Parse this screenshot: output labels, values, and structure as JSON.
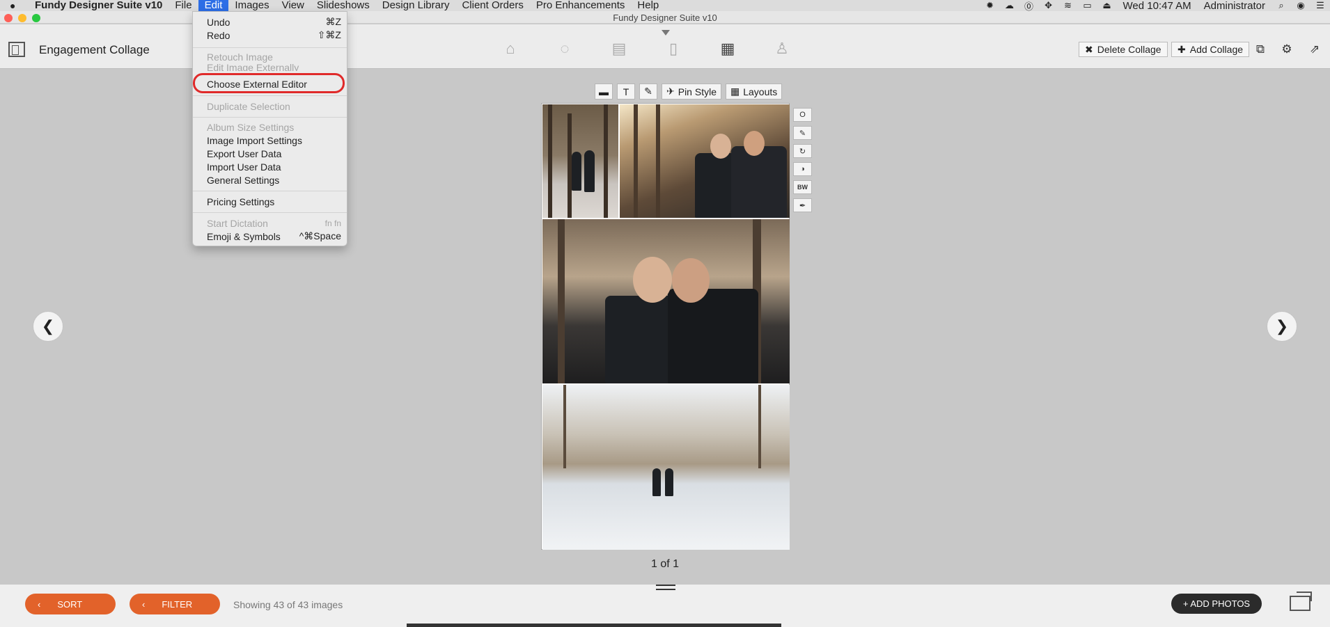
{
  "menubar": {
    "apple": "",
    "app_name": "Fundy Designer Suite v10",
    "items": [
      "File",
      "Edit",
      "Images",
      "View",
      "Slideshows",
      "Design Library",
      "Client Orders",
      "Pro Enhancements",
      "Help"
    ],
    "clock": "Wed 10:47 AM",
    "user": "Administrator",
    "status_icons": [
      "gear-burst-icon",
      "cloud-icon",
      "onepassword-icon",
      "move-icon",
      "wifi-icon",
      "airplay-icon",
      "eject-icon",
      "search-icon",
      "siri-icon",
      "list-icon"
    ]
  },
  "window": {
    "title": "Fundy Designer Suite v10"
  },
  "toolbar": {
    "collage_title": "Engagement Collage",
    "modules": [
      "album-icon",
      "proofing-icon",
      "wall-art-icon",
      "cards-icon",
      "collage-icon",
      "social-icon"
    ],
    "delete_collage": "Delete Collage",
    "add_collage": "Add Collage"
  },
  "edit_menu": {
    "items": [
      {
        "label": "Undo",
        "shortcut": "⌘Z",
        "disabled": false
      },
      {
        "label": "Redo",
        "shortcut": "⇧⌘Z",
        "disabled": false
      },
      {
        "label": "Retouch Image",
        "shortcut": "",
        "disabled": true
      },
      {
        "label": "Edit Image Externally",
        "shortcut": "",
        "disabled": true
      },
      {
        "label": "Choose External Editor",
        "shortcut": "",
        "disabled": false
      },
      {
        "label": "Duplicate Selection",
        "shortcut": "",
        "disabled": true
      },
      {
        "label": "Album Size Settings",
        "shortcut": "",
        "disabled": true
      },
      {
        "label": "Image Import Settings",
        "shortcut": "",
        "disabled": false
      },
      {
        "label": "Export User Data",
        "shortcut": "",
        "disabled": false
      },
      {
        "label": "Import User Data",
        "shortcut": "",
        "disabled": false
      },
      {
        "label": "General Settings",
        "shortcut": "",
        "disabled": false
      },
      {
        "label": "Pricing Settings",
        "shortcut": "",
        "disabled": false
      },
      {
        "label": "Start Dictation",
        "shortcut": "fn fn",
        "disabled": true
      },
      {
        "label": "Emoji & Symbols",
        "shortcut": "^⌘Space",
        "disabled": false
      }
    ]
  },
  "photo_toolbar": {
    "pin_style": "Pin Style",
    "layouts": "Layouts",
    "text_tool": "T"
  },
  "side_tools": {
    "bw": "BW",
    "circle": "O"
  },
  "page_indicator": "1 of 1",
  "bottom": {
    "sort": "SORT",
    "filter": "FILTER",
    "showing": "Showing 43 of 43 images",
    "add_photos": "+ ADD PHOTOS"
  },
  "colors": {
    "accent_orange": "#e2622a",
    "menu_highlight": "#2d6ee6",
    "annotation_ring": "#e02a2a"
  }
}
